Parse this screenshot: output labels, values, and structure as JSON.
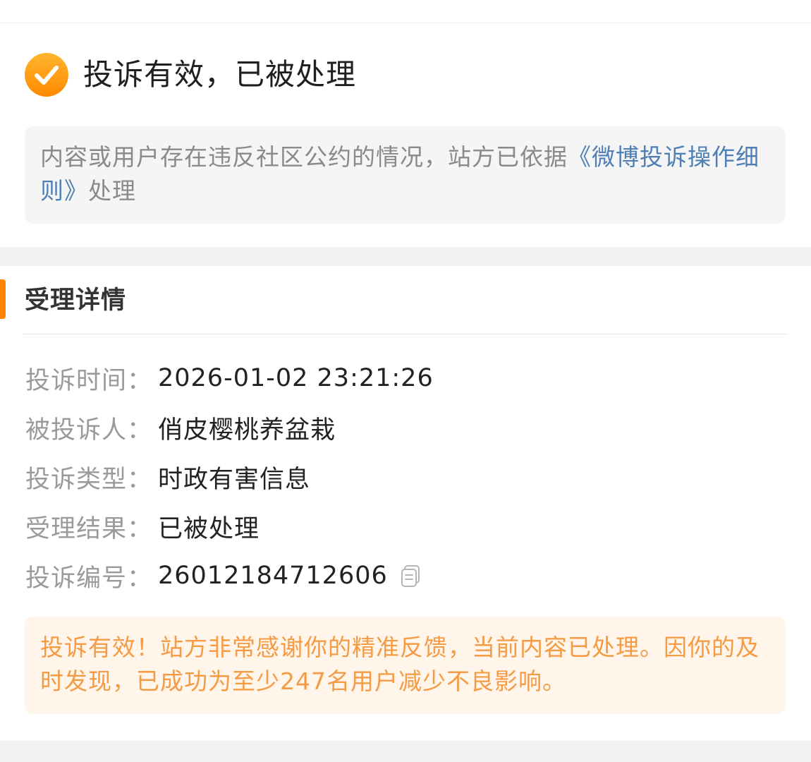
{
  "status": {
    "icon": "check-circle-icon",
    "title": "投诉有效，已被处理",
    "accent_color": "#ff8a00"
  },
  "notice": {
    "prefix": "内容或用户存在违反社区公约的情况，站方已依据",
    "link_text": "《微博投诉操作细则》",
    "suffix": "处理",
    "link_color": "#4f7fb5"
  },
  "details": {
    "section_title": "受理详情",
    "rows": [
      {
        "label": "投诉时间：",
        "value": "2026-01-02 23:21:26"
      },
      {
        "label": "被投诉人：",
        "value": "俏皮樱桃养盆栽"
      },
      {
        "label": "投诉类型：",
        "value": "时政有害信息"
      },
      {
        "label": "受理结果：",
        "value": "已被处理"
      },
      {
        "label": "投诉编号：",
        "value": "26012184712606",
        "icon": "copy-icon"
      }
    ]
  },
  "result_message": "投诉有效！站方非常感谢你的精准反馈，当前内容已处理。因你的及时发现，已成功为至少247名用户减少不良影响。"
}
